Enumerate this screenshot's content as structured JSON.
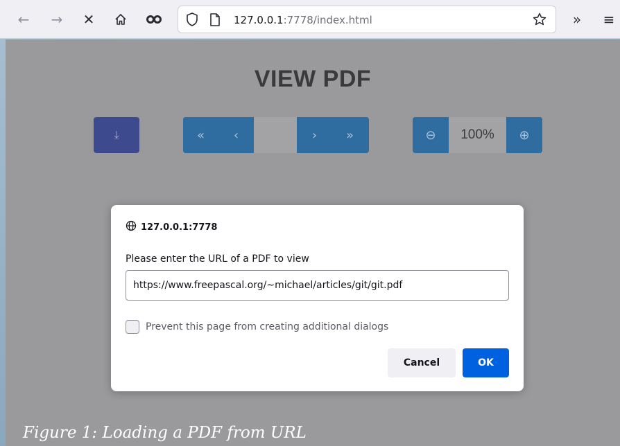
{
  "browser": {
    "back_icon": "←",
    "forward_icon": "→",
    "stop_icon": "✕",
    "home_icon": "⌂",
    "extension_icon": "∞",
    "url_host": "127.0.0.1",
    "url_rest": ":7778/index.html",
    "overflow_icon": "»",
    "menu_icon": "≡"
  },
  "page": {
    "title": "VIEW PDF",
    "download_icon": "⤓",
    "nav": {
      "first_icon": "«",
      "prev_icon": "‹",
      "page_value": "",
      "next_icon": "›",
      "last_icon": "»"
    },
    "zoom": {
      "zoom_out_icon": "⊖",
      "value": "100%",
      "zoom_in_icon": "⊕"
    }
  },
  "dialog": {
    "origin": "127.0.0.1:7778",
    "message": "Please enter the URL of a PDF to view",
    "input_value": "https://www.freepascal.org/~michael/articles/git/git.pdf",
    "checkbox_label": "Prevent this page from creating additional dialogs",
    "checkbox_checked": false,
    "cancel_label": "Cancel",
    "ok_label": "OK"
  },
  "caption": "Figure 1: Loading a PDF from URL"
}
